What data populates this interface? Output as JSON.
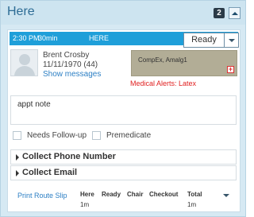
{
  "panel": {
    "title": "Here",
    "count": "2"
  },
  "appointment": {
    "time": "2:30 PM",
    "duration": "30min",
    "location": "HERE",
    "status": "Ready"
  },
  "patient": {
    "name": "Brent Crosby",
    "dob_age": "11/11/1970  (44)",
    "show_messages": "Show messages",
    "insurance": "CompEx, Amalg1",
    "medical_alerts": "Medical Alerts: Latex"
  },
  "note": {
    "value": "appt note"
  },
  "checkboxes": [
    {
      "label": "Needs Follow-up",
      "checked": false
    },
    {
      "label": "Premedicate",
      "checked": false
    }
  ],
  "sections": [
    {
      "title": "Collect Phone Number"
    },
    {
      "title": "Collect Email"
    }
  ],
  "footer": {
    "print_label": "Print Route Slip",
    "timings": [
      {
        "label": "Here",
        "value": "1m"
      },
      {
        "label": "Ready",
        "value": ""
      },
      {
        "label": "Chair",
        "value": ""
      },
      {
        "label": "Checkout",
        "value": ""
      },
      {
        "label": "Total",
        "value": "1m"
      }
    ]
  },
  "colors": {
    "status_bar": "#1f9fd9",
    "alert": "#e02020",
    "link": "#2c7fc4",
    "insurance_bg": "#b2ad96"
  },
  "icons": {
    "collapse": "chevron-up-icon",
    "status_dropdown": "chevron-down-icon",
    "section_expand": "triangle-right-icon",
    "insurance_flag": "plus-icon"
  }
}
